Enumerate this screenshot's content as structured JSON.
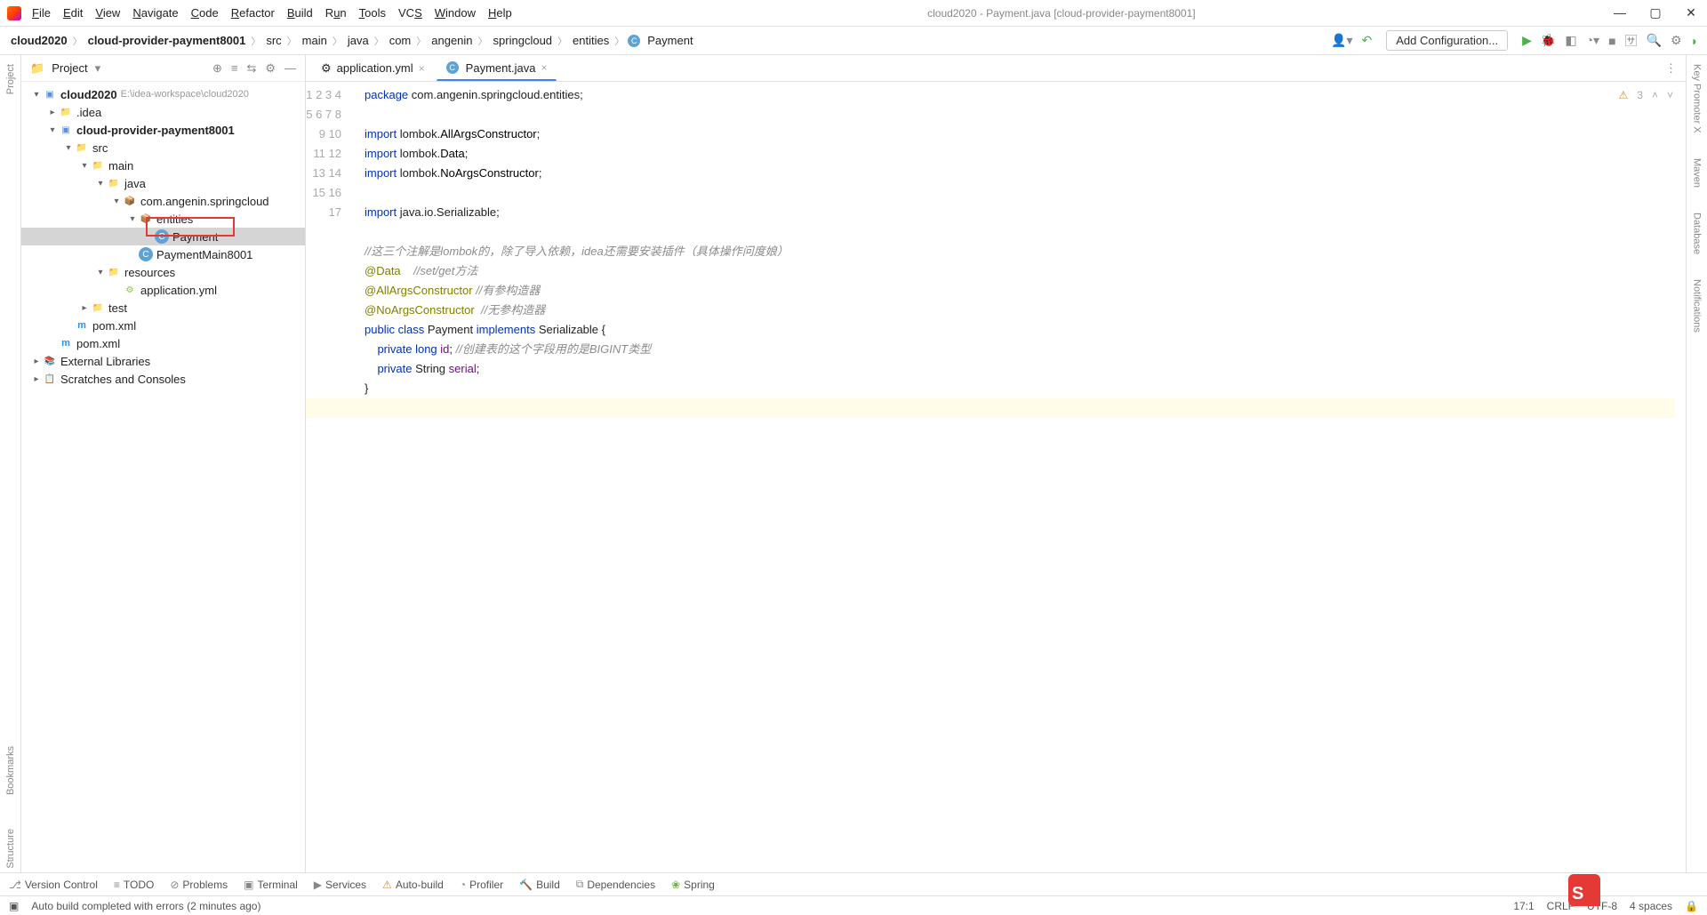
{
  "window": {
    "title": "cloud2020 - Payment.java [cloud-provider-payment8001]",
    "menu": [
      "File",
      "Edit",
      "View",
      "Navigate",
      "Code",
      "Refactor",
      "Build",
      "Run",
      "Tools",
      "VCS",
      "Window",
      "Help"
    ]
  },
  "breadcrumb": [
    "cloud2020",
    "cloud-provider-payment8001",
    "src",
    "main",
    "java",
    "com",
    "angenin",
    "springcloud",
    "entities",
    "Payment"
  ],
  "toolbar": {
    "addConfig": "Add Configuration..."
  },
  "projectPane": {
    "title": "Project",
    "root": {
      "name": "cloud2020",
      "hint": "E:\\idea-workspace\\cloud2020"
    },
    "nodes": {
      "idea": ".idea",
      "module": "cloud-provider-payment8001",
      "src": "src",
      "main": "main",
      "java": "java",
      "pkg": "com.angenin.springcloud",
      "entities": "entities",
      "payment": "Payment",
      "paymentMain": "PaymentMain8001",
      "resources": "resources",
      "appYml": "application.yml",
      "test": "test",
      "pom1": "pom.xml",
      "pom2": "pom.xml",
      "extLib": "External Libraries",
      "scratches": "Scratches and Consoles"
    }
  },
  "tabs": [
    {
      "icon": "yml",
      "label": "application.yml",
      "active": false
    },
    {
      "icon": "class",
      "label": "Payment.java",
      "active": true
    }
  ],
  "editor": {
    "warnCount": "3",
    "lines": 17
  },
  "code": {
    "l1a": "package",
    "l1b": " com.angenin.springcloud.entities;",
    "l3a": "import",
    "l3b": " lombok.",
    "l3c": "AllArgsConstructor",
    "l3d": ";",
    "l4a": "import",
    "l4b": " lombok.",
    "l4c": "Data",
    "l4d": ";",
    "l5a": "import",
    "l5b": " lombok.",
    "l5c": "NoArgsConstructor",
    "l5d": ";",
    "l7a": "import",
    "l7b": " java.io.Serializable;",
    "l9": "//这三个注解是lombok的，除了导入依赖，idea还需要安装插件（具体操作问度娘）",
    "l10a": "@Data",
    "l10b": "    //set/get方法",
    "l11a": "@AllArgsConstructor",
    "l11b": " //有参构造器",
    "l12a": "@NoArgsConstructor",
    "l12b": "  //无参构造器",
    "l13a": "public class ",
    "l13b": "Payment",
    "l13c": " implements ",
    "l13d": "Serializable {",
    "l14a": "    private long ",
    "l14b": "id",
    "l14c": "; ",
    "l14d": "//创建表的这个字段用的是BIGINT类型",
    "l15a": "    private ",
    "l15b": "String ",
    "l15c": "serial",
    "l15d": ";",
    "l16": "}"
  },
  "bottom": {
    "vcs": "Version Control",
    "todo": "TODO",
    "problems": "Problems",
    "terminal": "Terminal",
    "services": "Services",
    "autobuild": "Auto-build",
    "profiler": "Profiler",
    "build": "Build",
    "deps": "Dependencies",
    "spring": "Spring"
  },
  "status": {
    "msg": "Auto build completed with errors (2 minutes ago)",
    "pos": "17:1",
    "sep": "CRLF",
    "enc": "UTF-8",
    "indent": "4 spaces"
  },
  "rightTools": [
    "Key Promoter X",
    "Maven",
    "Database",
    "Notifications"
  ],
  "leftTools": [
    "Project",
    "Bookmarks",
    "Structure"
  ]
}
